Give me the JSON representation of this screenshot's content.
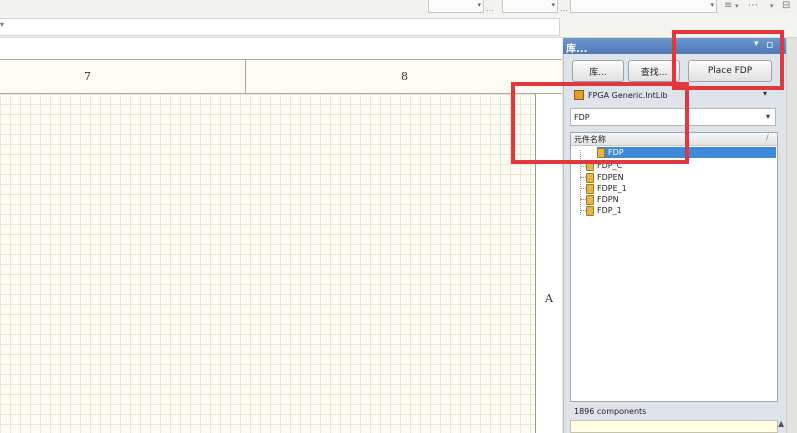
{
  "sheet": {
    "ruler_numbers": [
      "7",
      "8"
    ],
    "zone_label": "A"
  },
  "library_panel": {
    "title": "库...",
    "buttons": {
      "libraries": "库...",
      "search": "查找...",
      "place": "Place FDP"
    },
    "selected_library": "FPGA Generic.IntLib",
    "filter_value": "FDP",
    "list_header": "元件名称",
    "components": [
      "FDP",
      "FDP_C",
      "FDPEN",
      "FDPE_1",
      "FDPN",
      "FDP_1"
    ],
    "selected_component": "FDP",
    "status": "1896 components"
  },
  "colors": {
    "highlight": "#e0383c",
    "selection": "#3f8ad8",
    "panel_title": "#5b85c0"
  }
}
